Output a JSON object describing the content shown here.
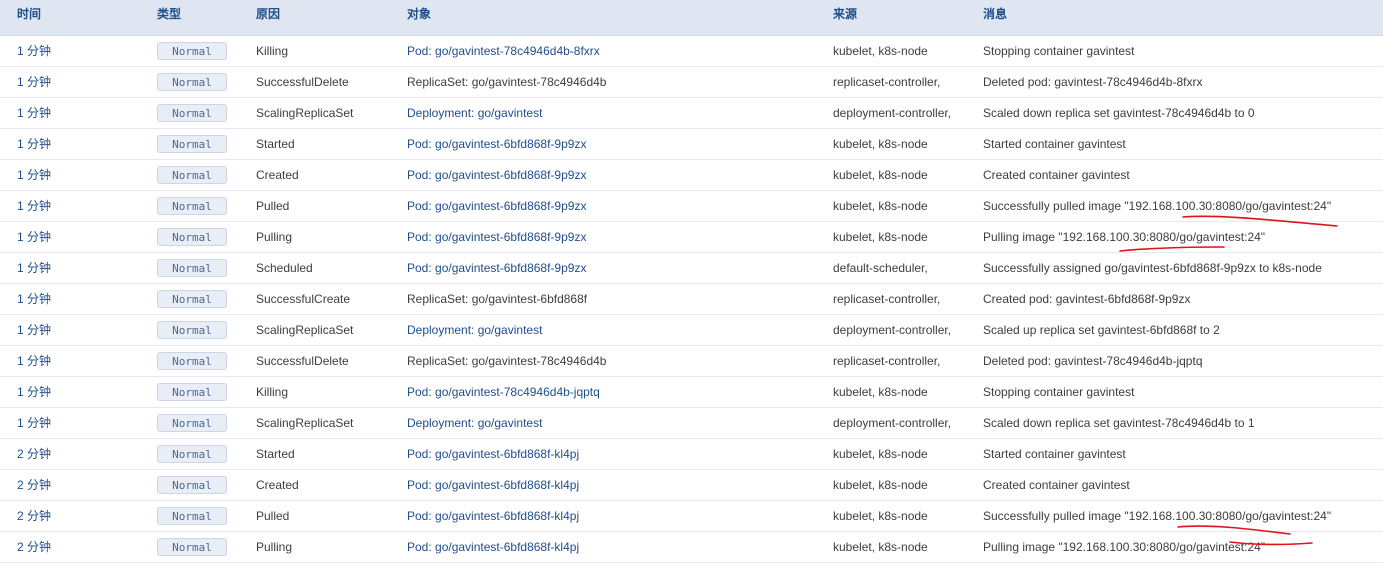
{
  "headers": {
    "time": "时间",
    "type": "类型",
    "reason": "原因",
    "object": "对象",
    "source": "来源",
    "message": "消息"
  },
  "rows": [
    {
      "time": "1 分钟",
      "type": "Normal",
      "reason": "Killing",
      "object": "Pod: go/gavintest-78c4946d4b-8fxrx",
      "object_link": true,
      "source": "kubelet, k8s-node",
      "message": "Stopping container gavintest"
    },
    {
      "time": "1 分钟",
      "type": "Normal",
      "reason": "SuccessfulDelete",
      "object": "ReplicaSet: go/gavintest-78c4946d4b",
      "object_link": false,
      "source": "replicaset-controller,",
      "message": "Deleted pod: gavintest-78c4946d4b-8fxrx"
    },
    {
      "time": "1 分钟",
      "type": "Normal",
      "reason": "ScalingReplicaSet",
      "object": "Deployment: go/gavintest",
      "object_link": true,
      "source": "deployment-controller,",
      "message": "Scaled down replica set gavintest-78c4946d4b to 0"
    },
    {
      "time": "1 分钟",
      "type": "Normal",
      "reason": "Started",
      "object": "Pod: go/gavintest-6bfd868f-9p9zx",
      "object_link": true,
      "source": "kubelet, k8s-node",
      "message": "Started container gavintest"
    },
    {
      "time": "1 分钟",
      "type": "Normal",
      "reason": "Created",
      "object": "Pod: go/gavintest-6bfd868f-9p9zx",
      "object_link": true,
      "source": "kubelet, k8s-node",
      "message": "Created container gavintest"
    },
    {
      "time": "1 分钟",
      "type": "Normal",
      "reason": "Pulled",
      "object": "Pod: go/gavintest-6bfd868f-9p9zx",
      "object_link": true,
      "source": "kubelet, k8s-node",
      "message": "Successfully pulled image \"192.168.100.30:8080/go/gavintest:24\""
    },
    {
      "time": "1 分钟",
      "type": "Normal",
      "reason": "Pulling",
      "object": "Pod: go/gavintest-6bfd868f-9p9zx",
      "object_link": true,
      "source": "kubelet, k8s-node",
      "message": "Pulling image \"192.168.100.30:8080/go/gavintest:24\""
    },
    {
      "time": "1 分钟",
      "type": "Normal",
      "reason": "Scheduled",
      "object": "Pod: go/gavintest-6bfd868f-9p9zx",
      "object_link": true,
      "source": "default-scheduler,",
      "message": "Successfully assigned go/gavintest-6bfd868f-9p9zx to k8s-node"
    },
    {
      "time": "1 分钟",
      "type": "Normal",
      "reason": "SuccessfulCreate",
      "object": "ReplicaSet: go/gavintest-6bfd868f",
      "object_link": false,
      "source": "replicaset-controller,",
      "message": "Created pod: gavintest-6bfd868f-9p9zx"
    },
    {
      "time": "1 分钟",
      "type": "Normal",
      "reason": "ScalingReplicaSet",
      "object": "Deployment: go/gavintest",
      "object_link": true,
      "source": "deployment-controller,",
      "message": "Scaled up replica set gavintest-6bfd868f to 2"
    },
    {
      "time": "1 分钟",
      "type": "Normal",
      "reason": "SuccessfulDelete",
      "object": "ReplicaSet: go/gavintest-78c4946d4b",
      "object_link": false,
      "source": "replicaset-controller,",
      "message": "Deleted pod: gavintest-78c4946d4b-jqptq"
    },
    {
      "time": "1 分钟",
      "type": "Normal",
      "reason": "Killing",
      "object": "Pod: go/gavintest-78c4946d4b-jqptq",
      "object_link": true,
      "source": "kubelet, k8s-node",
      "message": "Stopping container gavintest"
    },
    {
      "time": "1 分钟",
      "type": "Normal",
      "reason": "ScalingReplicaSet",
      "object": "Deployment: go/gavintest",
      "object_link": true,
      "source": "deployment-controller,",
      "message": "Scaled down replica set gavintest-78c4946d4b to 1"
    },
    {
      "time": "2 分钟",
      "type": "Normal",
      "reason": "Started",
      "object": "Pod: go/gavintest-6bfd868f-kl4pj",
      "object_link": true,
      "source": "kubelet, k8s-node",
      "message": "Started container gavintest"
    },
    {
      "time": "2 分钟",
      "type": "Normal",
      "reason": "Created",
      "object": "Pod: go/gavintest-6bfd868f-kl4pj",
      "object_link": true,
      "source": "kubelet, k8s-node",
      "message": "Created container gavintest"
    },
    {
      "time": "2 分钟",
      "type": "Normal",
      "reason": "Pulled",
      "object": "Pod: go/gavintest-6bfd868f-kl4pj",
      "object_link": true,
      "source": "kubelet, k8s-node",
      "message": "Successfully pulled image \"192.168.100.30:8080/go/gavintest:24\""
    },
    {
      "time": "2 分钟",
      "type": "Normal",
      "reason": "Pulling",
      "object": "Pod: go/gavintest-6bfd868f-kl4pj",
      "object_link": true,
      "source": "kubelet, k8s-node",
      "message": "Pulling image \"192.168.100.30:8080/go/gavintest:24\""
    }
  ],
  "colors": {
    "header_bg": "#dfe6f2",
    "header_text": "#1f4e8c",
    "link": "#1f4e8c",
    "badge_bg": "#e9eef6",
    "annotation": "#e0121b"
  }
}
